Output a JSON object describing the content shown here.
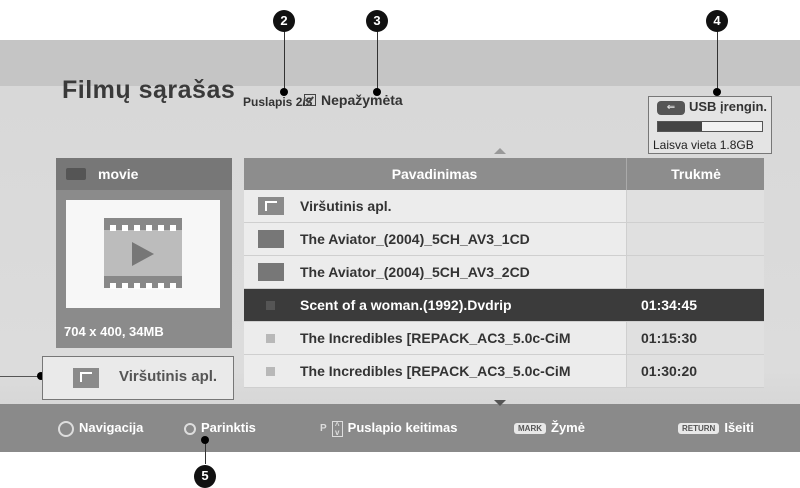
{
  "header": {
    "title": "Filmų sąrašas",
    "page_info": "Puslapis 2/3",
    "unmarked_label": "Nepažymėta"
  },
  "usb": {
    "label": "USB įrengin.",
    "free_space": "Laisva vieta 1.8GB",
    "used_fraction": 0.42
  },
  "folder_panel": {
    "folder_name": "movie",
    "thumbnail_info": "704 x 400, 34MB",
    "up_button_label": "Viršutinis apl."
  },
  "file_list": {
    "columns": [
      "Pavadinimas",
      "Trukmė"
    ],
    "rows": [
      {
        "name": "Viršutinis apl.",
        "duration": "",
        "icon": "up-folder-icon"
      },
      {
        "name": "The Aviator_(2004)_5CH_AV3_1CD",
        "duration": "",
        "icon": "folder-icon"
      },
      {
        "name": "The Aviator_(2004)_5CH_AV3_2CD",
        "duration": "",
        "icon": "folder-icon"
      },
      {
        "name": "Scent of a woman.(1992).Dvdrip",
        "duration": "01:34:45",
        "icon": "file-icon",
        "selected": true
      },
      {
        "name": "The Incredibles [REPACK_AC3_5.0c-CiM",
        "duration": "01:15:30",
        "icon": "file-icon"
      },
      {
        "name": "The Incredibles [REPACK_AC3_5.0c-CiM",
        "duration": "01:30:20",
        "icon": "file-icon"
      }
    ]
  },
  "bottom_bar": {
    "navigation": "Navigacija",
    "options": "Parinktis",
    "page_change": "Puslapio keitimas",
    "mark_key": "MARK",
    "mark": "Žymė",
    "return_key": "RETURN",
    "exit": "Išeiti"
  },
  "callouts": [
    "2",
    "3",
    "4",
    "5"
  ],
  "colors": {
    "highlight_row": "#3b3b3b",
    "header_bar": "#8d8d8d",
    "bottom_bar": "#8a8a8a"
  }
}
